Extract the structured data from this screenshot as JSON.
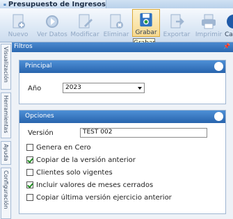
{
  "window": {
    "title": "Presupuesto de Ingresos"
  },
  "toolbar": {
    "buttons": [
      {
        "label": "Nuevo",
        "icon": "new-document-icon",
        "enabled": false
      },
      {
        "label": "Ver Datos",
        "icon": "view-data-icon",
        "enabled": false
      },
      {
        "label": "Modificar",
        "icon": "edit-icon",
        "enabled": false
      },
      {
        "label": "Eliminar",
        "icon": "delete-icon",
        "enabled": false
      },
      {
        "label": "Grabar",
        "icon": "save-icon",
        "enabled": true
      },
      {
        "label": "Exportar",
        "icon": "export-icon",
        "enabled": false
      },
      {
        "label": "Imprimir",
        "icon": "print-icon",
        "enabled": false
      },
      {
        "label": "Ca",
        "icon": "cancel-icon",
        "enabled": true
      }
    ],
    "tooltip": "Grabar"
  },
  "side_tabs": [
    "Visualización",
    "Herramientas",
    "Ayuda",
    "Configuración"
  ],
  "filters_bar": {
    "title": "Filtros",
    "pin": "↕"
  },
  "principal": {
    "title": "Principal",
    "year_label": "Año",
    "year_value": "2023"
  },
  "opciones": {
    "title": "Opciones",
    "version_label": "Versión",
    "version_value": "TEST 002",
    "checkboxes": [
      {
        "label": "Genera en Cero",
        "checked": false
      },
      {
        "label": "Copiar de la versión anterior",
        "checked": true
      },
      {
        "label": "Clientes solo vigentes",
        "checked": false
      },
      {
        "label": "Incluir valores de meses cerrados",
        "checked": true
      },
      {
        "label": "Copiar última versión ejercicio anterior",
        "checked": false
      }
    ]
  },
  "colors": {
    "accent": "#2a67b0",
    "toolbar_icon": "#3a78c4",
    "check": "#1f8a1f"
  }
}
